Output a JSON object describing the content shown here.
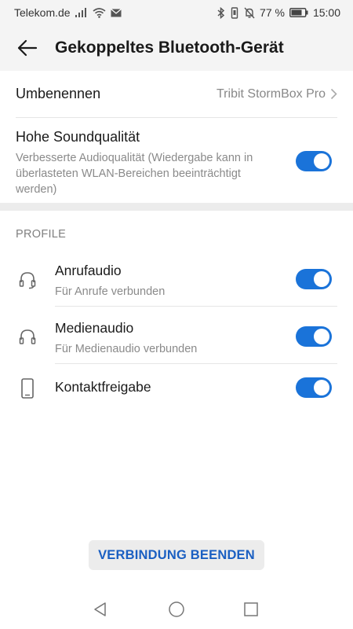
{
  "status_bar": {
    "carrier": "Telekom.de",
    "battery_percent": "77 %",
    "time": "15:00"
  },
  "app_bar": {
    "title": "Gekoppeltes Bluetooth-Gerät"
  },
  "device": {
    "rename_label": "Umbenennen",
    "device_name": "Tribit StormBox Pro",
    "hq_label": "Hohe Soundqualität",
    "hq_description": "Verbesserte Audioqualität (Wiedergabe kann in überlasteten WLAN-Bereichen beeinträchtigt werden)",
    "hq_enabled": true
  },
  "profiles": {
    "header": "PROFILE",
    "items": [
      {
        "title": "Anrufaudio",
        "subtitle": "Für Anrufe verbunden",
        "icon": "headset-icon",
        "enabled": true
      },
      {
        "title": "Medienaudio",
        "subtitle": "Für Medienaudio verbunden",
        "icon": "headphones-icon",
        "enabled": true
      },
      {
        "title": "Kontaktfreigabe",
        "subtitle": "",
        "icon": "phone-icon",
        "enabled": true
      }
    ]
  },
  "disconnect_label": "VERBINDUNG BEENDEN",
  "colors": {
    "accent": "#1a73d9",
    "button_text": "#1a5fc2"
  }
}
